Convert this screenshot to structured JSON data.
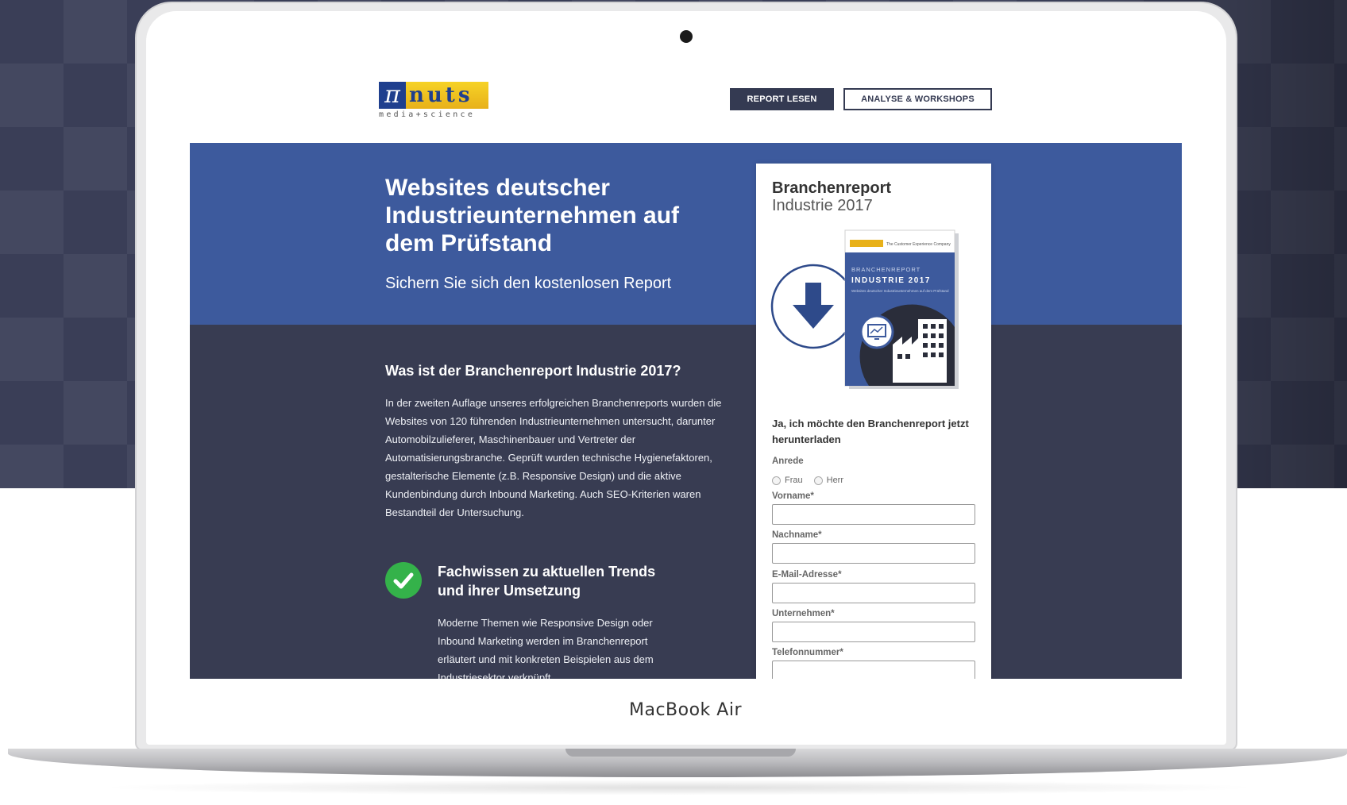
{
  "device": {
    "brand_label": "MacBook Air"
  },
  "header": {
    "logo": {
      "symbol": "π",
      "word": "nuts",
      "tagline": "media+science"
    },
    "nav": [
      {
        "label": "REPORT LESEN",
        "active": true
      },
      {
        "label": "ANALYSE & WORKSHOPS",
        "active": false
      }
    ]
  },
  "hero": {
    "title": "Websites deutscher Industrieunternehmen auf dem Prüfstand",
    "subtitle": "Sichern Sie sich den kostenlosen Report"
  },
  "section": {
    "title": "Was ist der Branchenreport Industrie 2017?",
    "body": "In der zweiten Auflage unseres erfolgreichen Branchenreports wurden die Websites von 120 führenden Industrieunternehmen untersucht, darunter Automobilzulieferer, Maschinenbauer und Vertreter der Automatisierungsbranche. Geprüft wurden technische Hygienefaktoren, gestalterische Elemente (z.B. Responsive Design) und die aktive Kundenbindung durch Inbound Marketing. Auch SEO-Kriterien waren Bestandteil der Untersuchung."
  },
  "feature": {
    "title": "Fachwissen zu aktuellen Trends und ihrer Umsetzung",
    "body": "Moderne Themen wie Responsive Design oder Inbound Marketing werden im Branchenreport erläutert und mit konkreten Beispielen aus dem Industriesektor verknüpft."
  },
  "form": {
    "title_line1": "Branchenreport",
    "title_line2": "Industrie 2017",
    "cover": {
      "header_text": "The Customer Experience Company",
      "kicker": "BRANCHENREPORT",
      "title": "INDUSTRIE 2017",
      "subtitle": "Websites deutscher Industrieunternehmen auf dem Prüfstand"
    },
    "cta": "Ja, ich möchte den Branchenreport jetzt herunterladen",
    "salutation_label": "Anrede",
    "salutation_options": [
      "Frau",
      "Herr"
    ],
    "fields": [
      {
        "label": "Vorname*",
        "value": ""
      },
      {
        "label": "Nachname*",
        "value": ""
      },
      {
        "label": "E-Mail-Adresse*",
        "value": ""
      },
      {
        "label": "Unternehmen*",
        "value": ""
      },
      {
        "label": "Telefonnummer*",
        "value": ""
      }
    ]
  },
  "colors": {
    "hero_blue": "#3d5a9d",
    "content_dark": "#383c52",
    "nav_dark": "#343a52",
    "check_green": "#34b24a"
  },
  "icons": [
    "download-arrow-icon",
    "monitor-chart-icon",
    "factory-icon",
    "checkmark-icon"
  ]
}
